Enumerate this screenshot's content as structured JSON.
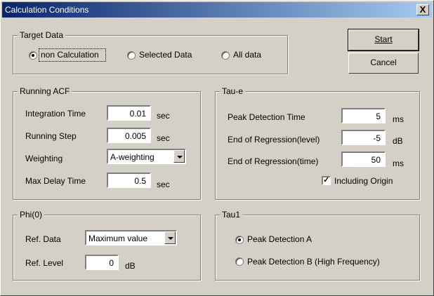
{
  "window": {
    "title": "Calculation Conditions",
    "close_glyph": "X"
  },
  "buttons": {
    "start": "Start",
    "cancel": "Cancel"
  },
  "target_data": {
    "legend": "Target Data",
    "options": [
      "non Calculation",
      "Selected Data",
      "All data"
    ],
    "selected": 0
  },
  "running_acf": {
    "legend": "Running ACF",
    "integration_time_label": "Integration Time",
    "integration_time": "0.01",
    "integration_time_unit": "sec",
    "running_step_label": "Running Step",
    "running_step": "0.005",
    "running_step_unit": "sec",
    "weighting_label": "Weighting",
    "weighting": "A-weighting",
    "max_delay_label": "Max Delay Time",
    "max_delay": "0.5",
    "max_delay_unit": "sec"
  },
  "tau_e": {
    "legend": "Tau-e",
    "peak_label": "Peak Detection Time",
    "peak": "5",
    "peak_unit": "ms",
    "reg_level_label": "End of Regression(level)",
    "reg_level": "-5",
    "reg_level_unit": "dB",
    "reg_time_label": "End of Regression(time)",
    "reg_time": "50",
    "reg_time_unit": "ms",
    "including_origin_label": "Including Origin",
    "including_origin": true
  },
  "phi0": {
    "legend": "Phi(0)",
    "ref_data_label": "Ref. Data",
    "ref_data": "Maximum value",
    "ref_level_label": "Ref. Level",
    "ref_level": "0",
    "ref_level_unit": "dB"
  },
  "tau1": {
    "legend": "Tau1",
    "options": [
      "Peak Detection A",
      "Peak Detection B (High Frequency)"
    ],
    "selected": 0
  }
}
